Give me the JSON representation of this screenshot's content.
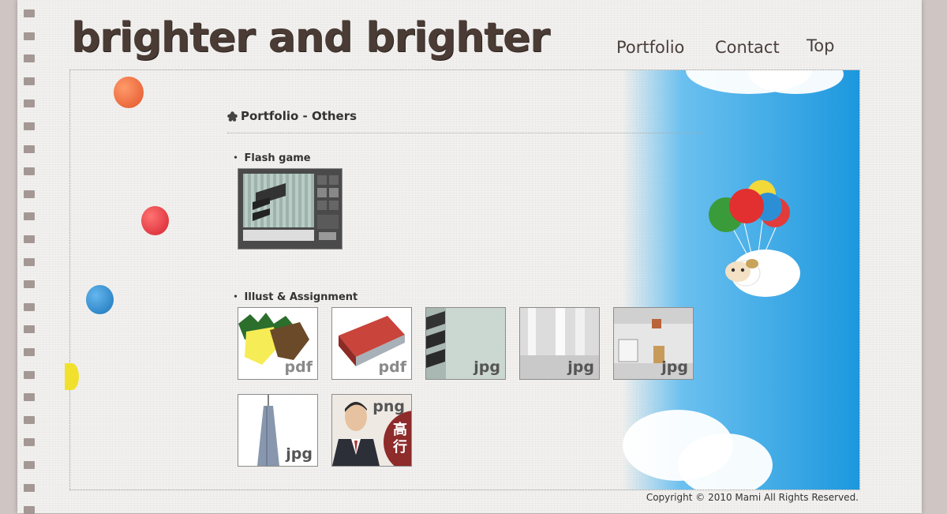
{
  "site": {
    "logo": "brighter and brighter"
  },
  "nav": {
    "portfolio": "Portfolio",
    "contact": "Contact",
    "top": "Top"
  },
  "page": {
    "title": "Portfolio - Others",
    "section_flash": "・ Flash game",
    "section_illust": "・ Illust & Assignment"
  },
  "thumbs": [
    {
      "format": "pdf"
    },
    {
      "format": "pdf"
    },
    {
      "format": "jpg"
    },
    {
      "format": "jpg"
    },
    {
      "format": "jpg"
    },
    {
      "format": "jpg"
    },
    {
      "format": "png",
      "overlay": "高\n行"
    }
  ],
  "footer": {
    "copyright": "Copyright © 2010 Mami All Rights Reserved."
  },
  "colors": {
    "text": "#333333",
    "logo": "#4a3b35",
    "sky": "#1c98de",
    "accent_red": "#e53a3a"
  }
}
